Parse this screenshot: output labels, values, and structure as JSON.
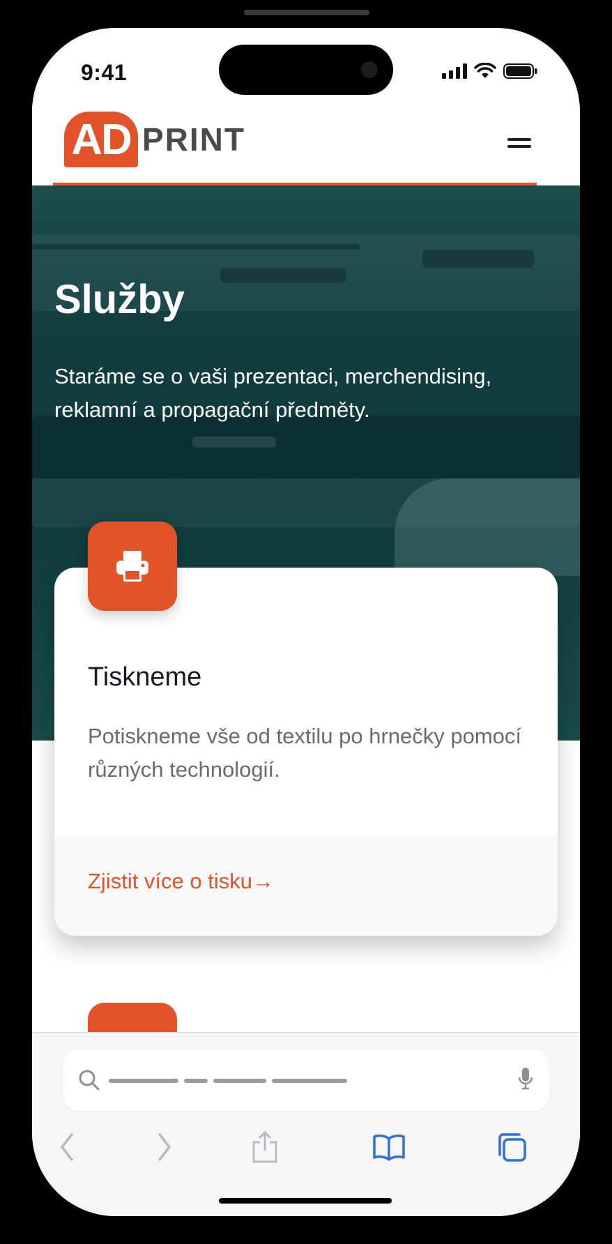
{
  "status_bar": {
    "time": "9:41"
  },
  "header": {
    "logo_mark": "AD",
    "logo_word": "PRINT"
  },
  "hero": {
    "title": "Služby",
    "text": "Staráme se o vaši prezentaci, merchendising, reklamní a propagační předměty."
  },
  "card": {
    "title": "Tiskneme",
    "text": "Potiskneme vše od textilu po hrnečky pomocí různých technologií.",
    "link": "Zjistit více o tisku→"
  },
  "colors": {
    "accent": "#e2532a",
    "hero_bg": "#123f40",
    "safari_blue": "#2f6fe0"
  },
  "icons": [
    "printer-icon",
    "menu-icon",
    "search-icon",
    "microphone-icon",
    "back-icon",
    "forward-icon",
    "share-icon",
    "bookmarks-icon",
    "tabs-icon"
  ]
}
